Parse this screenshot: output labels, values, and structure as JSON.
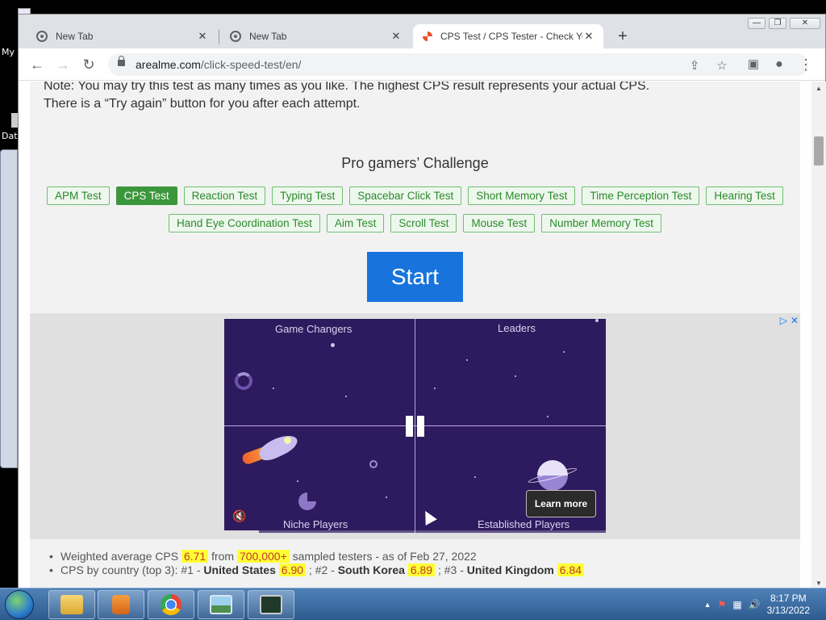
{
  "desktop": {
    "labels": [
      "My",
      "Dat"
    ]
  },
  "browser": {
    "tabs": [
      {
        "title": "New Tab",
        "close": "✕",
        "active": false
      },
      {
        "title": "New Tab",
        "close": "✕",
        "active": false
      },
      {
        "title": "CPS Test / CPS Tester - Check Yo",
        "close": "✕",
        "active": true
      }
    ],
    "new_tab": "+",
    "window_controls": {
      "minimize": "—",
      "restore": "❐",
      "close": "✕"
    },
    "nav": {
      "back": "←",
      "forward": "→",
      "reload": "↻"
    },
    "url_host": "arealme.com",
    "url_path": "/click-speed-test/en/",
    "omnibox_icons": {
      "share": "⇪",
      "bookmark": "☆"
    },
    "toolbar_icons": {
      "sidebar": "▣",
      "profile": "●",
      "menu": "⋮"
    }
  },
  "page": {
    "note_line1": "Note: You may try this test as many times as you like. The highest CPS result represents your actual CPS.",
    "note_line2": "There is a “Try again” button for you after each attempt.",
    "challenge_title": "Pro gamers’ Challenge",
    "tests_row1": [
      "APM Test",
      "CPS Test",
      "Reaction Test",
      "Typing Test",
      "Spacebar Click Test",
      "Short Memory Test",
      "Time Perception Test",
      "Hearing Test"
    ],
    "tests_row2": [
      "Hand Eye Coordination Test",
      "Aim Test",
      "Scroll Test",
      "Mouse Test",
      "Number Memory Test"
    ],
    "selected_test": "CPS Test",
    "start_label": "Start",
    "ad": {
      "choice_icons": [
        "▷",
        "✕"
      ],
      "quadrants": {
        "top_left": "Game Changers",
        "top_right": "Leaders",
        "bottom_left": "Niche Players",
        "bottom_right": "Established Players"
      },
      "learn_more": "Learn more",
      "mute_icon": "🔇",
      "progress": 0.09
    },
    "stats": {
      "line1_prefix": "Weighted average CPS",
      "avg_cps": "6.71",
      "line1_from": "from",
      "testers": "700,000+",
      "line1_suffix": "sampled testers - as of Feb 27, 2022",
      "line2_prefix": "CPS by country (top 3): #1 -",
      "country1": "United States",
      "cps1": "6.90",
      "sep2": "; #2 -",
      "country2": "South Korea",
      "cps2": "6.89",
      "sep3": "; #3 -",
      "country3": "United Kingdom",
      "cps3": "6.84"
    }
  },
  "taskbar": {
    "time": "8:17 PM",
    "date": "3/13/2022",
    "tray_icons": [
      "▲",
      "⚑",
      "▦",
      "🔊"
    ]
  },
  "colors": {
    "start_button": "#1874dc",
    "chip_green": "#3c963c",
    "highlight": "#ffff33",
    "ad_background": "#2e1a5e"
  }
}
